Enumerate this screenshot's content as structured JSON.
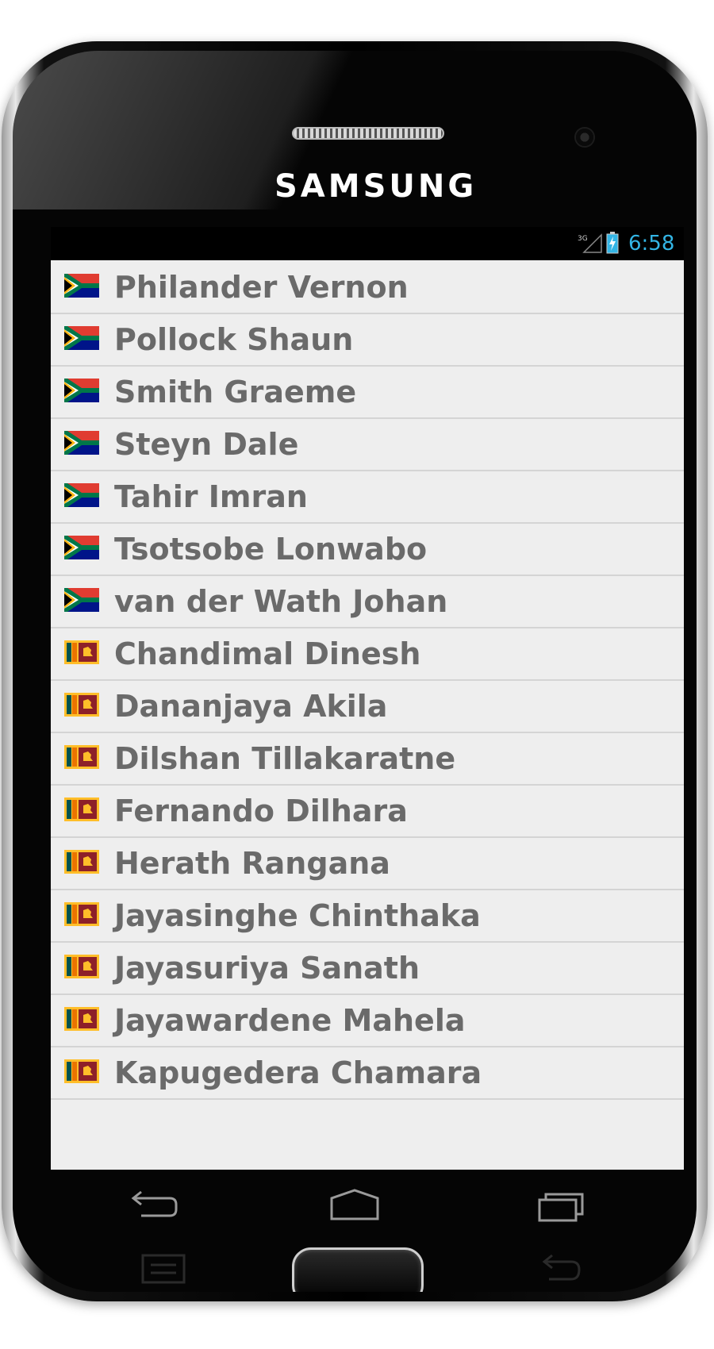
{
  "device": {
    "brand": "SAMSUNG"
  },
  "status_bar": {
    "network": "3G",
    "time": "6:58",
    "accent_color": "#33b5e5"
  },
  "players": [
    {
      "name": "Philander Vernon",
      "flag": "south-africa-flag-icon"
    },
    {
      "name": "Pollock Shaun",
      "flag": "south-africa-flag-icon"
    },
    {
      "name": "Smith Graeme",
      "flag": "south-africa-flag-icon"
    },
    {
      "name": "Steyn Dale",
      "flag": "south-africa-flag-icon"
    },
    {
      "name": "Tahir Imran",
      "flag": "south-africa-flag-icon"
    },
    {
      "name": "Tsotsobe Lonwabo",
      "flag": "south-africa-flag-icon"
    },
    {
      "name": "van der Wath Johan",
      "flag": "south-africa-flag-icon"
    },
    {
      "name": "Chandimal Dinesh",
      "flag": "sri-lanka-flag-icon"
    },
    {
      "name": "Dananjaya Akila",
      "flag": "sri-lanka-flag-icon"
    },
    {
      "name": "Dilshan Tillakaratne",
      "flag": "sri-lanka-flag-icon"
    },
    {
      "name": "Fernando Dilhara",
      "flag": "sri-lanka-flag-icon"
    },
    {
      "name": "Herath Rangana",
      "flag": "sri-lanka-flag-icon"
    },
    {
      "name": "Jayasinghe Chinthaka",
      "flag": "sri-lanka-flag-icon"
    },
    {
      "name": "Jayasuriya Sanath",
      "flag": "sri-lanka-flag-icon"
    },
    {
      "name": "Jayawardene Mahela",
      "flag": "sri-lanka-flag-icon"
    },
    {
      "name": "Kapugedera Chamara",
      "flag": "sri-lanka-flag-icon"
    }
  ],
  "nav_icons": [
    "back-icon",
    "home-icon",
    "recent-apps-icon"
  ],
  "hardware_icons": [
    "menu-key-icon",
    "back-key-icon"
  ]
}
